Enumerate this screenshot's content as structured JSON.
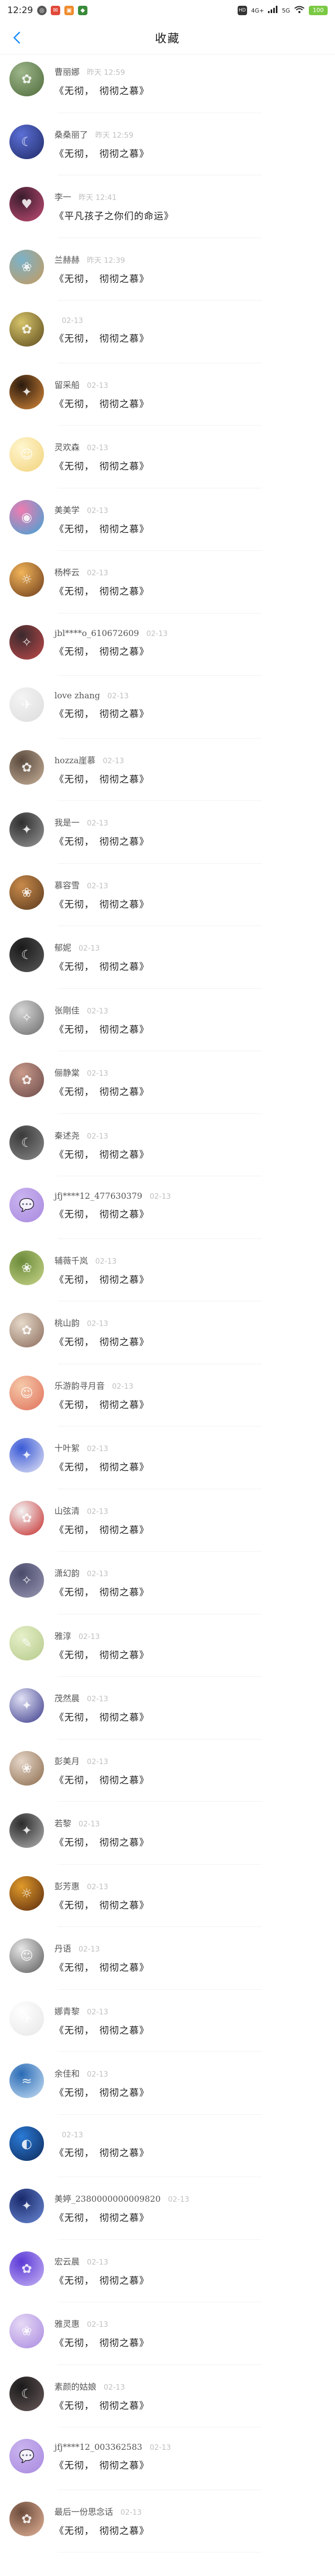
{
  "status_bar": {
    "time": "12:29",
    "network_1": "4G+",
    "network_2": "5G",
    "battery": "100"
  },
  "header": {
    "title": "收藏"
  },
  "colors": {
    "accent": "#1a8cff",
    "meta": "#bfbfbf"
  },
  "items": [
    {
      "name": "曹丽娜",
      "time": "昨天 12:59",
      "text": "《无彻，　彻彻之慕》",
      "c1": "#9db58a",
      "c2": "#4e6b3a",
      "glyph": "✿"
    },
    {
      "name": "桑桑丽了",
      "time": "昨天 12:59",
      "text": "《无彻，　彻彻之慕》",
      "c1": "#5b6fd6",
      "c2": "#202a66",
      "glyph": "☾"
    },
    {
      "name": "李一",
      "time": "昨天 12:41",
      "text": "《平凡孩子之你们的命运》",
      "c1": "#3a1d2e",
      "c2": "#c44d75",
      "glyph": "♥"
    },
    {
      "name": "兰赫赫",
      "time": "昨天 12:39",
      "text": "《无彻，　彻彻之慕》",
      "c1": "#7bb2c9",
      "c2": "#c79a5c",
      "glyph": "❀"
    },
    {
      "name": "",
      "time": "02-13",
      "text": "《无彻，　彻彻之慕》",
      "c1": "#d6c46b",
      "c2": "#5c4a1c",
      "glyph": "✿"
    },
    {
      "name": "留采船",
      "time": "02-13",
      "text": "《无彻，　彻彻之慕》",
      "c1": "#2a1a0e",
      "c2": "#d98a3a",
      "glyph": "✦"
    },
    {
      "name": "灵欢森",
      "time": "02-13",
      "text": "《无彻，　彻彻之慕》",
      "c1": "#fff6cf",
      "c2": "#f2d27a",
      "glyph": "☺"
    },
    {
      "name": "美美学",
      "time": "02-13",
      "text": "《无彻，　彻彻之慕》",
      "c1": "#f07bb0",
      "c2": "#3aa6d6",
      "glyph": "◉"
    },
    {
      "name": "杨桦云",
      "time": "02-13",
      "text": "《无彻，　彻彻之慕》",
      "c1": "#f2b55a",
      "c2": "#6b3a1a",
      "glyph": "☼"
    },
    {
      "name": "jbl****o_610672609",
      "time": "02-13",
      "text": "《无彻，　彻彻之慕》",
      "c1": "#3a2a2e",
      "c2": "#c24a4a",
      "glyph": "✧"
    },
    {
      "name": "love zhang",
      "time": "02-13",
      "text": "《无彻，　彻彻之慕》",
      "c1": "#f4f4f4",
      "c2": "#dcdcdc",
      "glyph": "✈"
    },
    {
      "name": "hozza崖慕",
      "time": "02-13",
      "text": "《无彻，　彻彻之慕》",
      "c1": "#5a4a3e",
      "c2": "#c9b29a",
      "glyph": "✿"
    },
    {
      "name": "我是一",
      "time": "02-13",
      "text": "《无彻，　彻彻之慕》",
      "c1": "#2e2e2e",
      "c2": "#9a9a9a",
      "glyph": "✦"
    },
    {
      "name": "慕容雪",
      "time": "02-13",
      "text": "《无彻，　彻彻之慕》",
      "c1": "#c98a4a",
      "c2": "#5a3a1e",
      "glyph": "❀"
    },
    {
      "name": "郁妮",
      "time": "02-13",
      "text": "《无彻，　彻彻之慕》",
      "c1": "#1a1a1a",
      "c2": "#5a5a5a",
      "glyph": "☾"
    },
    {
      "name": "张剛佳",
      "time": "02-13",
      "text": "《无彻，　彻彻之慕》",
      "c1": "#d6d6d6",
      "c2": "#6a6a6a",
      "glyph": "✧"
    },
    {
      "name": "俪静棠",
      "time": "02-13",
      "text": "《无彻，　彻彻之慕》",
      "c1": "#c99a8a",
      "c2": "#6b4a4a",
      "glyph": "✿"
    },
    {
      "name": "秦述尧",
      "time": "02-13",
      "text": "《无彻，　彻彻之慕》",
      "c1": "#3a3a3a",
      "c2": "#8a8a8a",
      "glyph": "☾"
    },
    {
      "name": "jfj****12_477630379",
      "time": "02-13",
      "text": "《无彻，　彻彻之慕》",
      "c1": "#c9b3ee",
      "c2": "#a98ae0",
      "glyph": "💬"
    },
    {
      "name": "辅薇千岚",
      "time": "02-13",
      "text": "《无彻，　彻彻之慕》",
      "c1": "#6b8a3a",
      "c2": "#c9d68a",
      "glyph": "❀"
    },
    {
      "name": "桃山韵",
      "time": "02-13",
      "text": "《无彻，　彻彻之慕》",
      "c1": "#e6d9c9",
      "c2": "#8a6a5a",
      "glyph": "✿"
    },
    {
      "name": "乐游韵寻月音",
      "time": "02-13",
      "text": "《无彻，　彻彻之慕》",
      "c1": "#f5c9a9",
      "c2": "#e0705a",
      "glyph": "☺"
    },
    {
      "name": "十叶絮",
      "time": "02-13",
      "text": "《无彻，　彻彻之慕》",
      "c1": "#3a5ad6",
      "c2": "#e6e6f5",
      "glyph": "✦"
    },
    {
      "name": "山弦清",
      "time": "02-13",
      "text": "《无彻，　彻彻之慕》",
      "c1": "#f4f4f4",
      "c2": "#c42a2a",
      "glyph": "✿"
    },
    {
      "name": "潇幻韵",
      "time": "02-13",
      "text": "《无彻，　彻彻之慕》",
      "c1": "#4a4a6b",
      "c2": "#9a9ab5",
      "glyph": "✧"
    },
    {
      "name": "雅淳",
      "time": "02-13",
      "text": "《无彻，　彻彻之慕》",
      "c1": "#e6f0c9",
      "c2": "#b5c98a",
      "glyph": "✎"
    },
    {
      "name": "茂然晨",
      "time": "02-13",
      "text": "《无彻，　彻彻之慕》",
      "c1": "#e0e0f5",
      "c2": "#3a3a8a",
      "glyph": "✦"
    },
    {
      "name": "彭美月",
      "time": "02-13",
      "text": "《无彻，　彻彻之慕》",
      "c1": "#e6d6c9",
      "c2": "#8a6a4a",
      "glyph": "❀"
    },
    {
      "name": "若黎",
      "time": "02-13",
      "text": "《无彻，　彻彻之慕》",
      "c1": "#2a2a2a",
      "c2": "#b5b5b5",
      "glyph": "✦"
    },
    {
      "name": "彭芳惠",
      "time": "02-13",
      "text": "《无彻，　彻彻之慕》",
      "c1": "#e09a2a",
      "c2": "#5a2a0e",
      "glyph": "☼"
    },
    {
      "name": "丹语",
      "time": "02-13",
      "text": "《无彻，　彻彻之慕》",
      "c1": "#e6e6e6",
      "c2": "#5a5a5a",
      "glyph": "☺"
    },
    {
      "name": "娜青黎",
      "time": "02-13",
      "text": "《无彻，　彻彻之慕》",
      "c1": "#ffffff",
      "c2": "#e6e6e6",
      "glyph": "✈"
    },
    {
      "name": "余佳和",
      "time": "02-13",
      "text": "《无彻，　彻彻之慕》",
      "c1": "#2a6bb5",
      "c2": "#c9e0f5",
      "glyph": "≈"
    },
    {
      "name": "",
      "time": "02-13",
      "text": "《无彻，　彻彻之慕》",
      "c1": "#2a7ad6",
      "c2": "#0e2a5a",
      "glyph": "◐"
    },
    {
      "name": "美婷_2380000000009820",
      "time": "02-13",
      "text": "《无彻，　彻彻之慕》",
      "c1": "#1a2a6b",
      "c2": "#6b8ad6",
      "glyph": "✦"
    },
    {
      "name": "宏云晨",
      "time": "02-13",
      "text": "《无彻，　彻彻之慕》",
      "c1": "#5a3ad6",
      "c2": "#c9b5f5",
      "glyph": "✿"
    },
    {
      "name": "雅灵惠",
      "time": "02-13",
      "text": "《无彻，　彻彻之慕》",
      "c1": "#e6d9f5",
      "c2": "#a98ae0",
      "glyph": "❀"
    },
    {
      "name": "素颜的姑娘",
      "time": "02-13",
      "text": "《无彻，　彻彻之慕》",
      "c1": "#1a1a1a",
      "c2": "#6a5a5a",
      "glyph": "☾"
    },
    {
      "name": "jfj****12_003362583",
      "time": "02-13",
      "text": "《无彻，　彻彻之慕》",
      "c1": "#c9b3ee",
      "c2": "#a98ae0",
      "glyph": "💬"
    },
    {
      "name": "最后一份思念话",
      "time": "02-13",
      "text": "《无彻，　彻彻之慕》",
      "c1": "#6b4a3a",
      "c2": "#e6b59a",
      "glyph": "✿"
    }
  ]
}
